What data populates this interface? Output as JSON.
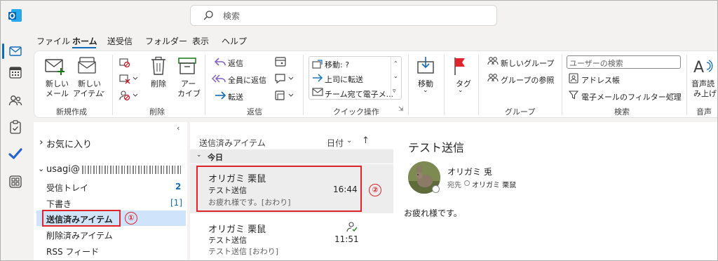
{
  "search": {
    "placeholder": "検索"
  },
  "menu": [
    "ファイル",
    "ホーム",
    "送受信",
    "フォルダー",
    "表示",
    "ヘルプ"
  ],
  "ribbon": {
    "new_mail_1": "新しい",
    "new_mail_2": "メール",
    "new_item_1": "新しい",
    "new_item_2": "アイテム",
    "grp_new": "新規作成",
    "delete": "削除",
    "archive_1": "アー",
    "archive_2": "カイブ",
    "grp_delete": "削除",
    "reply": "返信",
    "reply_all": "全員に返信",
    "forward": "転送",
    "grp_respond": "返信",
    "qs1": "移動: ?",
    "qs2": "上司に転送",
    "qs3": "チーム宛て電子メ...",
    "grp_quick": "クイック操作",
    "move": "移動",
    "grp_move": "",
    "tags": "タグ",
    "new_group": "新しいグループ",
    "browse_groups": "グループの参照",
    "grp_groups": "グループ",
    "search_people": "ユーザーの検索",
    "address_book": "アドレス帳",
    "filter_email": "電子メールのフィルター処理",
    "grp_find": "検索",
    "read_aloud_1": "音声読",
    "read_aloud_2": "み上げ",
    "grp_speech": "音声"
  },
  "folders": {
    "favorites": "お気に入り",
    "account": "usagi@",
    "inbox": "受信トレイ",
    "inbox_count": "2",
    "drafts": "下書き",
    "drafts_count": "[1]",
    "sent": "送信済みアイテム",
    "deleted": "削除済みアイテム",
    "rss": "RSS フィード"
  },
  "list": {
    "header": "送信済みアイテム",
    "sort": "日付",
    "group_today": "今日",
    "items": [
      {
        "sender": "オリガミ 栗鼠",
        "subject": "テスト送信",
        "time": "16:44",
        "preview": "お疲れ様です。[おわり]"
      },
      {
        "sender": "オリガミ 栗鼠",
        "subject": "テスト送信",
        "time": "11:51",
        "preview": "テスト送信 [おわり]"
      }
    ]
  },
  "reading": {
    "subject": "テスト送信",
    "from": "オリガミ 兎",
    "to_label": "宛先",
    "to": "オリガミ 栗鼠",
    "body": "お疲れ様です。"
  },
  "annotations": {
    "one": "①",
    "two": "②"
  },
  "colors": {
    "accent": "#0f6cbd",
    "annotation": "#e0242b",
    "selected": "#cfe4fa"
  }
}
